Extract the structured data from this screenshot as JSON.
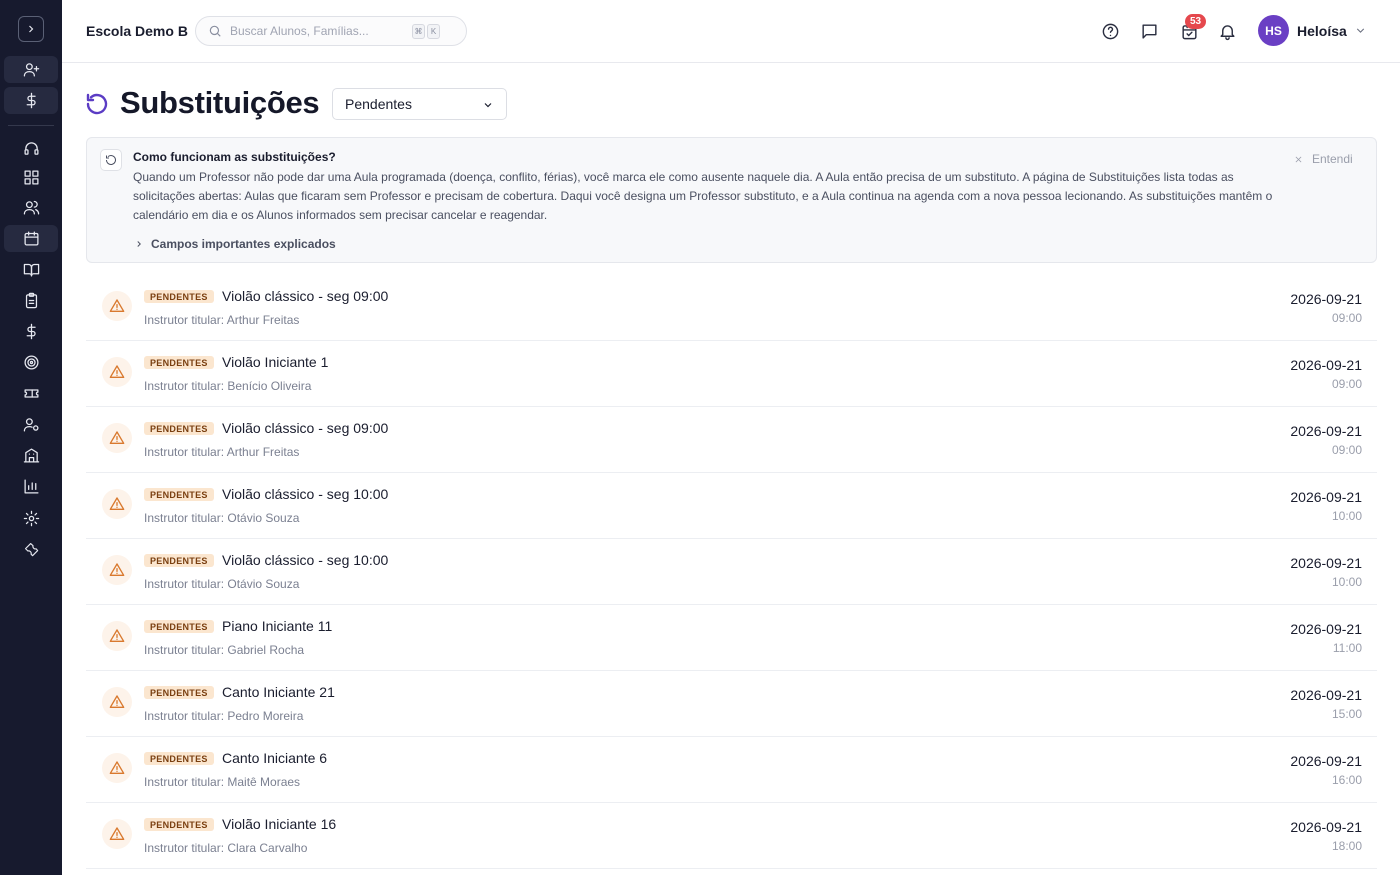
{
  "app": {
    "school_name": "Escola Demo B",
    "search_placeholder": "Buscar Alunos, Famílias...",
    "search_kbd": [
      "⌘",
      "K"
    ],
    "notification_count": "53",
    "user_initials": "HS",
    "user_name": "Heloísa"
  },
  "sidebar": {
    "items": [
      "add-user",
      "finance",
      "support",
      "dashboard",
      "people",
      "calendar",
      "courses",
      "assignments",
      "payments",
      "goals",
      "tickets",
      "instructors",
      "buildings",
      "reports",
      "settings",
      "tools"
    ],
    "active": "calendar"
  },
  "page": {
    "title": "Substituições",
    "filter_value": "Pendentes"
  },
  "info_box": {
    "title": "Como funcionam as substituições?",
    "body": "Quando um Professor não pode dar uma Aula programada (doença, conflito, férias), você marca ele como ausente naquele dia. A Aula então precisa de um substituto. A página de Substituições lista todas as solicitações abertas: Aulas que ficaram sem Professor e precisam de cobertura. Daqui você designa um Professor substituto, e a Aula continua na agenda com a nova pessoa lecionando. As substituições mantêm o calendário em dia e os Alunos informados sem precisar cancelar e reagendar.",
    "details_link": "Campos importantes explicados",
    "dismiss_label": "Entendi"
  },
  "list": {
    "status_label": "PENDENTES",
    "instructor_prefix": "Instrutor titular: ",
    "items": [
      {
        "title": "Violão clássico - seg 09:00",
        "instructor": "Instrutor titular: Arthur Freitas",
        "date": "2026-09-21",
        "time": "09:00"
      },
      {
        "title": "Violão Iniciante 1",
        "instructor": "Instrutor titular: Benício Oliveira",
        "date": "2026-09-21",
        "time": "09:00"
      },
      {
        "title": "Violão clássico - seg 09:00",
        "instructor": "Instrutor titular: Arthur Freitas",
        "date": "2026-09-21",
        "time": "09:00"
      },
      {
        "title": "Violão clássico - seg 10:00",
        "instructor": "Instrutor titular: Otávio Souza",
        "date": "2026-09-21",
        "time": "10:00"
      },
      {
        "title": "Violão clássico - seg 10:00",
        "instructor": "Instrutor titular: Otávio Souza",
        "date": "2026-09-21",
        "time": "10:00"
      },
      {
        "title": "Piano Iniciante 11",
        "instructor": "Instrutor titular: Gabriel Rocha",
        "date": "2026-09-21",
        "time": "11:00"
      },
      {
        "title": "Canto Iniciante 21",
        "instructor": "Instrutor titular: Pedro Moreira",
        "date": "2026-09-21",
        "time": "15:00"
      },
      {
        "title": "Canto Iniciante 6",
        "instructor": "Instrutor titular: Maitê Moraes",
        "date": "2026-09-21",
        "time": "16:00"
      },
      {
        "title": "Violão Iniciante 16",
        "instructor": "Instrutor titular: Clara Carvalho",
        "date": "2026-09-21",
        "time": "18:00"
      }
    ]
  },
  "colors": {
    "sidebar_bg": "#171a2e",
    "accent": "#5b3cc4",
    "avatar": "#6a3fc4",
    "badge": "#e5484d",
    "warning": "#d9792e",
    "pill_bg": "#fbe6cf"
  }
}
